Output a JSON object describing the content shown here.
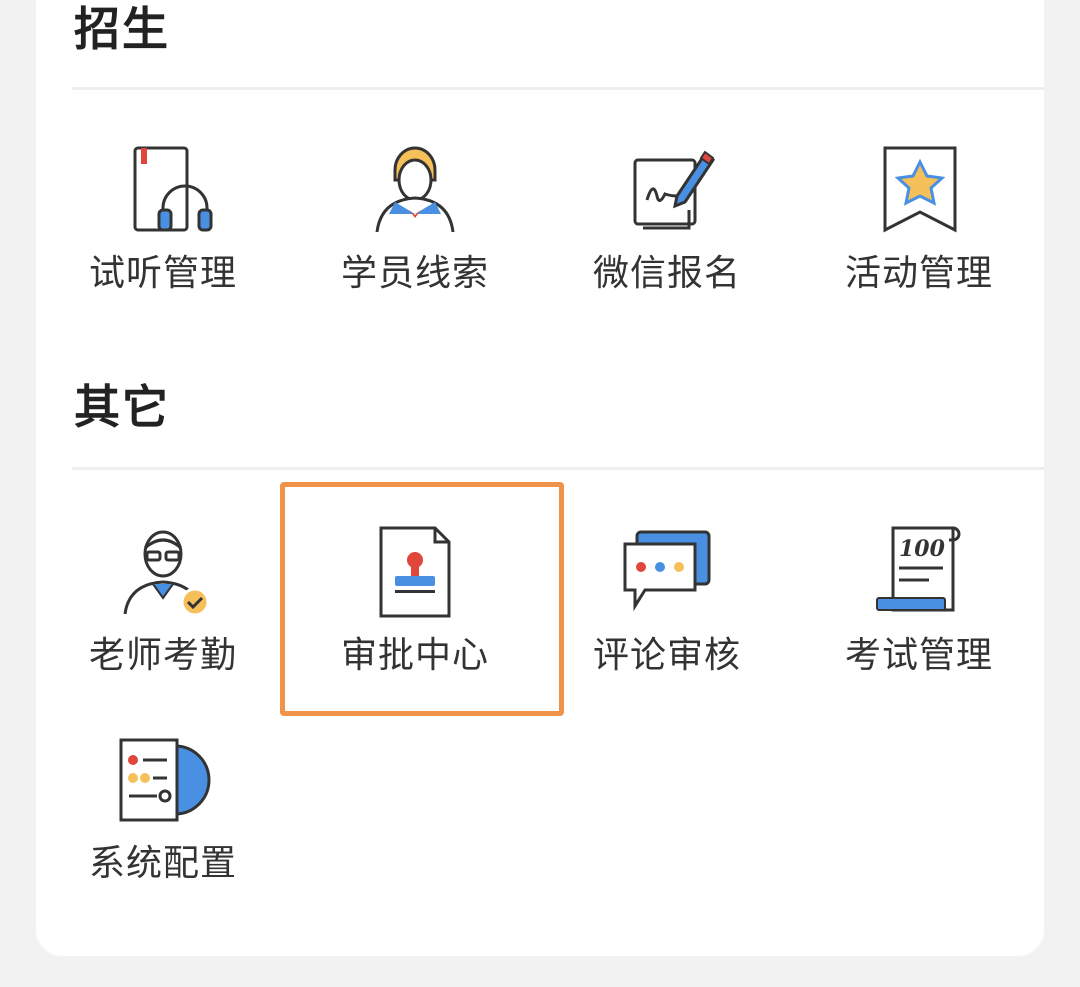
{
  "sections": [
    {
      "title": "招生",
      "items": [
        {
          "label": "试听管理",
          "icon": "audit-listening-book-icon"
        },
        {
          "label": "学员线索",
          "icon": "student-person-icon"
        },
        {
          "label": "微信报名",
          "icon": "signature-pen-icon"
        },
        {
          "label": "活动管理",
          "icon": "star-bookmark-icon"
        }
      ]
    },
    {
      "title": "其它",
      "items": [
        {
          "label": "老师考勤",
          "icon": "teacher-check-icon"
        },
        {
          "label": "审批中心",
          "icon": "stamp-document-icon"
        },
        {
          "label": "评论审核",
          "icon": "comment-bubble-icon"
        },
        {
          "label": "考试管理",
          "icon": "exam-score-icon"
        },
        {
          "label": "系统配置",
          "icon": "settings-gear-document-icon"
        }
      ]
    }
  ],
  "highlight_color": "#f0934a",
  "accent_color": "#4a90e2"
}
